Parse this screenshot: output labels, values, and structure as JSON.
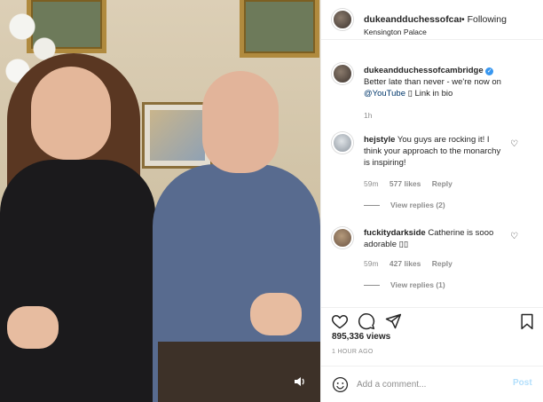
{
  "media": {
    "description_icon": "speaker-icon"
  },
  "header": {
    "username": "dukeandduchessofcam",
    "following": "• Following",
    "location": "Kensington Palace"
  },
  "caption": {
    "username": "dukeandduchessofcambridge",
    "text_before": "Better late than never - we're now on",
    "link": "@YouTube",
    "text_after": "▯ Link in bio",
    "time": "1h"
  },
  "comments": [
    {
      "username": "hejstyle",
      "text": "You guys are rocking it! I think your approach to the monarchy is inspiring!",
      "time": "59m",
      "likes": "577 likes",
      "reply": "Reply",
      "view_replies": "View replies (2)"
    },
    {
      "username": "fuckitydarkside",
      "text": "Catherine is sooo adorable ▯▯",
      "time": "59m",
      "likes": "427 likes",
      "reply": "Reply",
      "view_replies": "View replies (1)"
    }
  ],
  "stats": {
    "views": "895,336 views",
    "time_ago": "1 HOUR AGO"
  },
  "add_comment": {
    "placeholder": "Add a comment...",
    "post": "Post"
  },
  "colors": {
    "link": "#00376b",
    "verified": "#3897f0",
    "post_disabled": "#b2dffc",
    "muted": "#8e8e8e"
  }
}
